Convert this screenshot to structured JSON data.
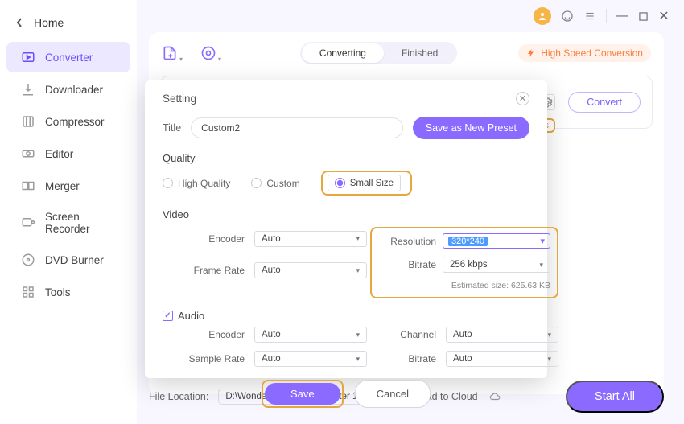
{
  "titlebar": {
    "min": "—",
    "max": "□",
    "close": "✕"
  },
  "nav": {
    "back_label": "Home",
    "items": [
      {
        "label": "Converter"
      },
      {
        "label": "Downloader"
      },
      {
        "label": "Compressor"
      },
      {
        "label": "Editor"
      },
      {
        "label": "Merger"
      },
      {
        "label": "Screen Recorder"
      },
      {
        "label": "DVD Burner"
      },
      {
        "label": "Tools"
      }
    ]
  },
  "main": {
    "tabs": {
      "left": "Converting",
      "right": "Finished"
    },
    "high_speed": "High Speed Conversion",
    "convert": "Convert",
    "settings_chip": "tings",
    "start_all": "Start All"
  },
  "footer": {
    "file_location_label": "File Location:",
    "file_location_value": "D:\\Wondershare UniConverter 1",
    "upload_label": "Upload to Cloud"
  },
  "modal": {
    "header": "Setting",
    "title_label": "Title",
    "title_value": "Custom2",
    "save_preset": "Save as New Preset",
    "quality_label": "Quality",
    "quality_options": {
      "high": "High Quality",
      "custom": "Custom",
      "small": "Small Size"
    },
    "video_label": "Video",
    "audio_label": "Audio",
    "fields": {
      "encoder": "Encoder",
      "frame_rate": "Frame Rate",
      "sample_rate": "Sample Rate",
      "resolution": "Resolution",
      "bitrate": "Bitrate",
      "channel": "Channel"
    },
    "values": {
      "auto": "Auto",
      "resolution": "320*240",
      "video_bitrate": "256 kbps",
      "estimated": "Estimated size: 625.63 KB"
    },
    "save": "Save",
    "cancel": "Cancel"
  }
}
